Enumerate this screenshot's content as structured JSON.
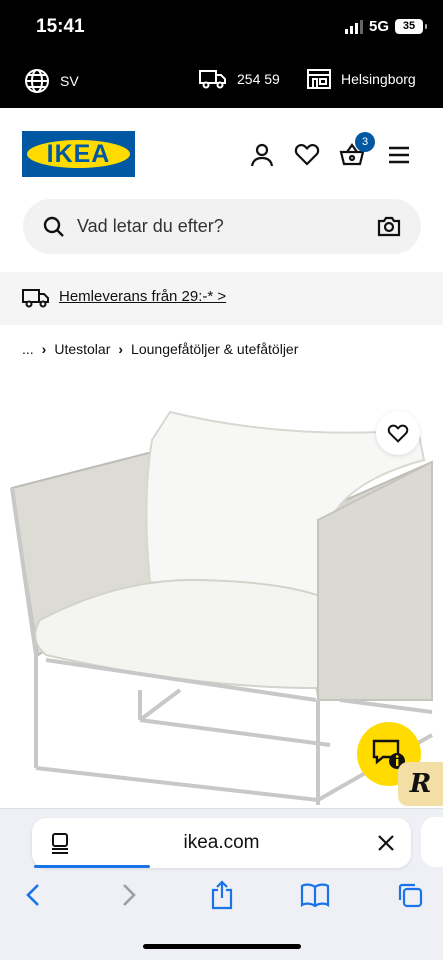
{
  "status_bar": {
    "time": "15:41",
    "network": "5G",
    "battery": "35"
  },
  "top_bar": {
    "language": "SV",
    "postcode": "254 59",
    "store": "Helsingborg"
  },
  "header": {
    "logo_text": "IKEA",
    "cart_count": "3",
    "icons": [
      "profile-icon",
      "heart-icon",
      "basket-icon",
      "menu-icon"
    ]
  },
  "search": {
    "placeholder": "Vad letar du efter?"
  },
  "delivery": {
    "text": "Hemleverans från 29:-* >"
  },
  "breadcrumb": {
    "ellipsis": "...",
    "items": [
      "Utestolar",
      "Loungefåtöljer & utefåtöljer"
    ]
  },
  "browser": {
    "url": "ikea.com"
  },
  "colors": {
    "ikea_blue": "#0058a3",
    "ikea_yellow": "#ffdb00",
    "black": "#000000"
  }
}
